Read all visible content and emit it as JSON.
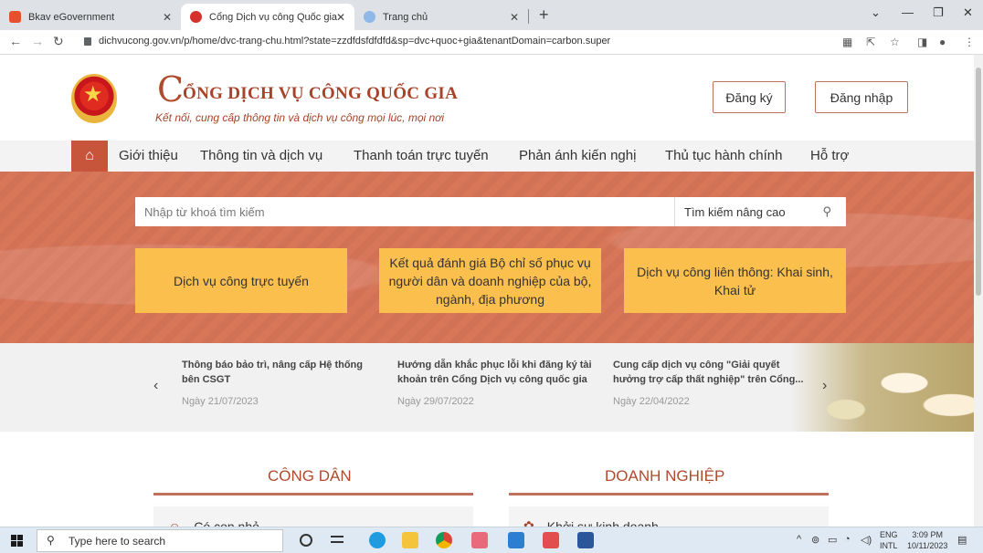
{
  "browser": {
    "tabs": [
      {
        "title": "Bkav eGovernment",
        "active": false
      },
      {
        "title": "Cổng Dịch vụ công Quốc gia",
        "active": true
      },
      {
        "title": "Trang chủ",
        "active": false
      }
    ],
    "new_tab": "+",
    "url": "dichvucong.gov.vn/p/home/dvc-trang-chu.html?state=zzdfdsfdfdfd&sp=dvc+quoc+gia&tenantDomain=carbon.super"
  },
  "header": {
    "title": "ỔNG DỊCH VỤ CÔNG QUỐC GIA",
    "logo_letter": "C",
    "slogan": "Kết nối, cung cấp thông tin và dịch vụ công mọi lúc, mọi nơi",
    "register_label": "Đăng ký",
    "login_label": "Đăng nhập"
  },
  "nav": {
    "items": [
      "Giới thiệu",
      "Thông tin và dịch vụ",
      "Thanh toán trực tuyến",
      "Phản ánh kiến nghị",
      "Thủ tục hành chính",
      "Hỗ trợ"
    ]
  },
  "hero": {
    "search_placeholder": "Nhập từ khoá tìm kiếm",
    "advanced_search": "Tìm kiếm nâng cao",
    "tiles": [
      "Dịch vụ công trực tuyến",
      "Kết quả đánh giá Bộ chỉ số phục vụ người dân và doanh nghiệp của bộ, ngành, địa phương",
      "Dịch vụ công liên thông: Khai sinh, Khai tử"
    ]
  },
  "news": {
    "items": [
      {
        "title": "Thông báo bảo trì, nâng cấp Hệ thống bên CSGT",
        "date": "Ngày 21/07/2023"
      },
      {
        "title": "Hướng dẫn khắc phục lỗi khi đăng ký tài khoản trên Cổng Dịch vụ công quốc gia",
        "date": "Ngày 29/07/2022"
      },
      {
        "title": "Cung cấp dịch vụ công \"Giải quyết hưởng trợ cấp thất nghiệp\" trên Cổng...",
        "date": "Ngày 22/04/2022"
      }
    ]
  },
  "sections": {
    "citizen": {
      "title": "CÔNG DÂN",
      "first_item": "Có con nhỏ"
    },
    "business": {
      "title": "DOANH NGHIỆP",
      "first_item": "Khởi sự kinh doanh"
    }
  },
  "taskbar": {
    "search_placeholder": "Type here to search",
    "lang_top": "ENG",
    "lang_bottom": "INTL",
    "time": "3:09 PM",
    "date": "10/11/2023"
  },
  "colors": {
    "brand": "#a8422a",
    "hero_bg": "#d8765a",
    "tile_bg": "#fbbf4e",
    "nav_home": "#c7553b"
  }
}
